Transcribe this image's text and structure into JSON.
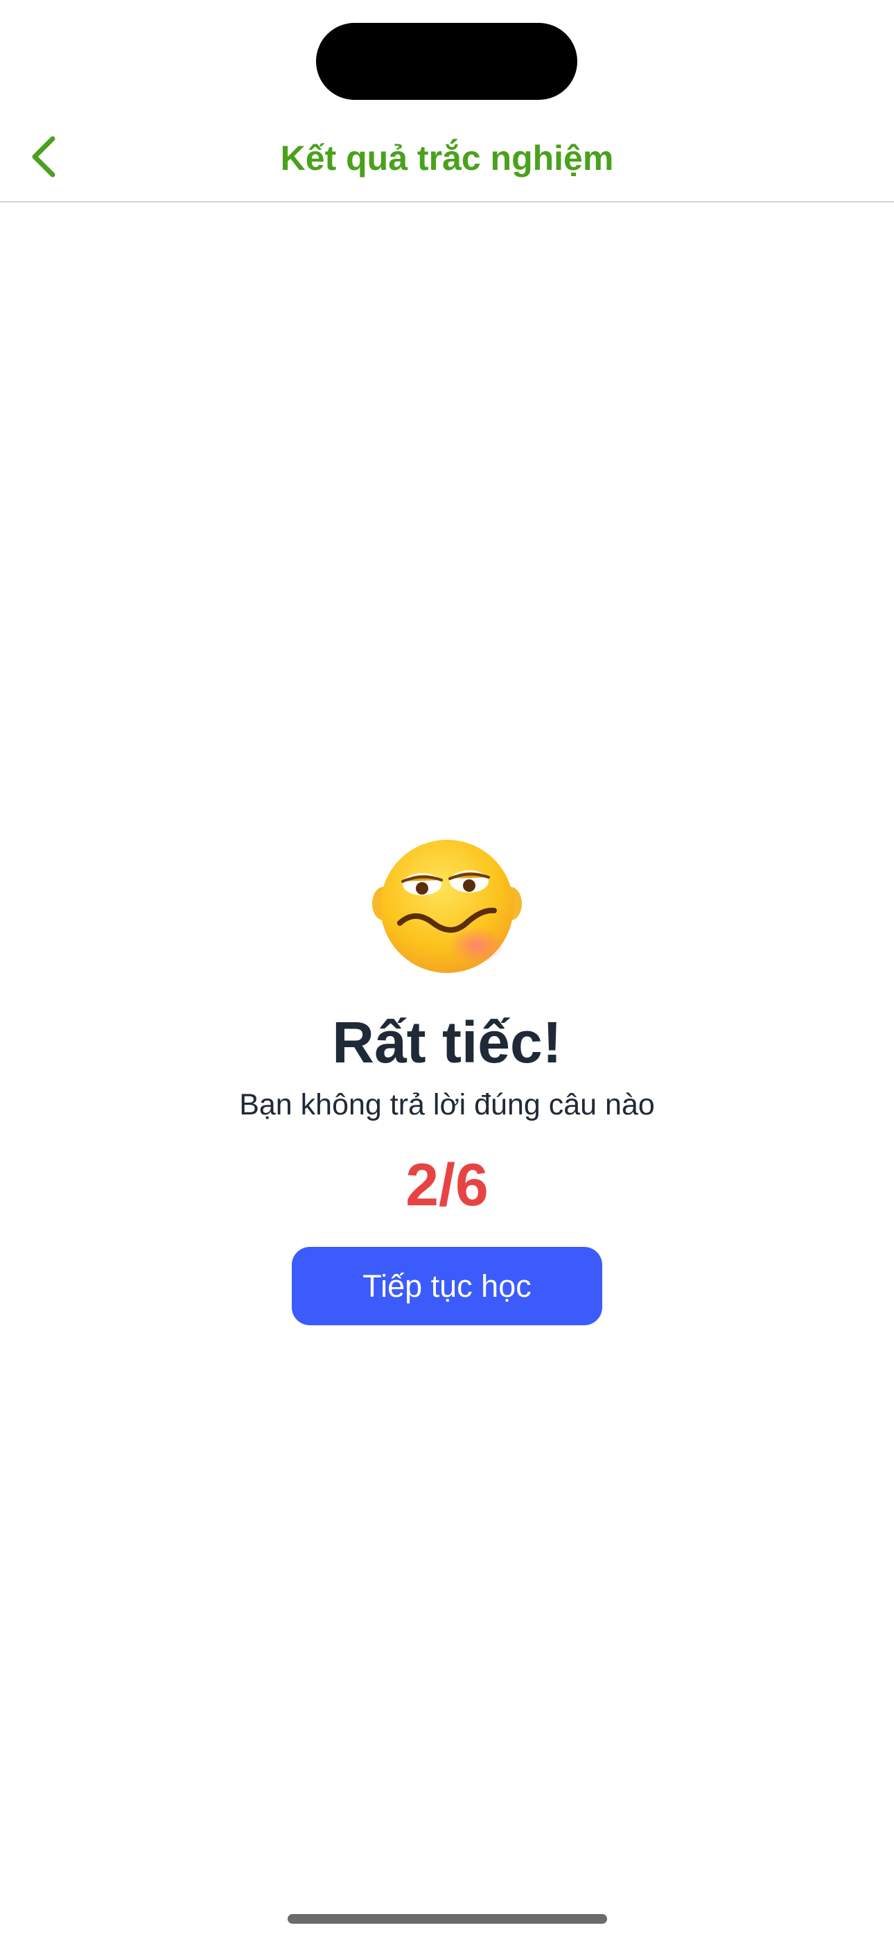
{
  "header": {
    "title": "Kết quả trắc nghiệm",
    "back_icon": "chevron-left-icon",
    "accent_color": "#4aa11c"
  },
  "result": {
    "emoji_icon": "woozy-face-emoji",
    "title": "Rất tiếc!",
    "subtitle": "Bạn không trả lời đúng câu nào",
    "score": "2/6",
    "score_color": "#e84343"
  },
  "actions": {
    "continue_label": "Tiếp tục học",
    "button_color": "#3b5bfb"
  }
}
